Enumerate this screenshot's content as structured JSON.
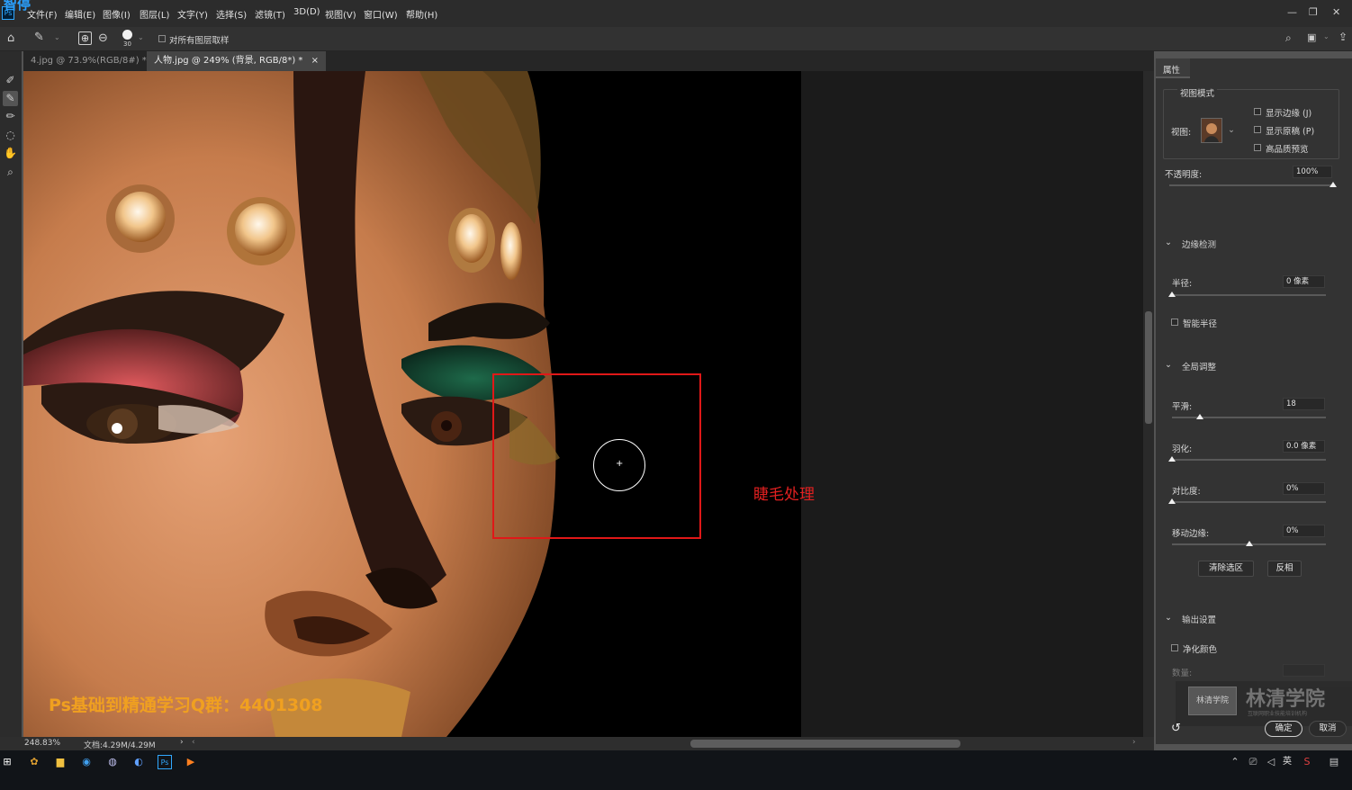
{
  "app": {
    "overlay_text": "智停",
    "logo_text": "Ps"
  },
  "menu": [
    "文件(F)",
    "编辑(E)",
    "图像(I)",
    "图层(L)",
    "文字(Y)",
    "选择(S)",
    "滤镜(T)",
    "3D(D)",
    "视图(V)",
    "窗口(W)",
    "帮助(H)"
  ],
  "options": {
    "brush_size": "30",
    "sample_all_layers": "对所有图层取样",
    "sample_all_checked": false
  },
  "tabs": [
    {
      "label": "4.jpg @ 73.9%(RGB/8#) *",
      "active": false
    },
    {
      "label": "人物.jpg @ 249% (背景, RGB/8*) *",
      "active": true
    }
  ],
  "canvas": {
    "annotation": "睫毛处理",
    "annotation_color": "#e02020",
    "watermark": "Ps基础到精通学习Q群：4401308",
    "watermark_color": "#f0a020"
  },
  "status": {
    "zoom": "248.83%",
    "doc": "文档:4.29M/4.29M"
  },
  "panel": {
    "title": "属性",
    "view_mode": {
      "heading": "视图模式",
      "view_label": "视图:",
      "show_edge": "显示边缘 (J)",
      "show_original": "显示原稿 (P)",
      "hq_preview": "高品质预览"
    },
    "opacity": {
      "label": "不透明度:",
      "value": "100%",
      "fraction": 1.0
    },
    "edge_detection": {
      "heading": "边缘检测",
      "radius_label": "半径:",
      "radius_value": "0 像素",
      "radius_fraction": 0.0,
      "smart_radius": "智能半径"
    },
    "global_refine": {
      "heading": "全局调整",
      "smooth_label": "平滑:",
      "smooth_value": "18",
      "smooth_fraction": 0.18,
      "feather_label": "羽化:",
      "feather_value": "0.0 像素",
      "feather_fraction": 0.0,
      "contrast_label": "对比度:",
      "contrast_value": "0%",
      "contrast_fraction": 0.0,
      "shift_label": "移动边缘:",
      "shift_value": "0%",
      "shift_fraction": 0.5,
      "clear_btn": "清除选区",
      "invert_btn": "反相"
    },
    "output": {
      "heading": "输出设置",
      "decontaminate": "净化颜色",
      "amount_label": "数量:"
    },
    "ok_btn": "确定",
    "cancel_btn": "取消",
    "brand": "林清学院",
    "brand_small_logo": "林清学院",
    "brand_sub": "互联网职业技能培训机构"
  },
  "tray": {
    "lang": "英"
  }
}
